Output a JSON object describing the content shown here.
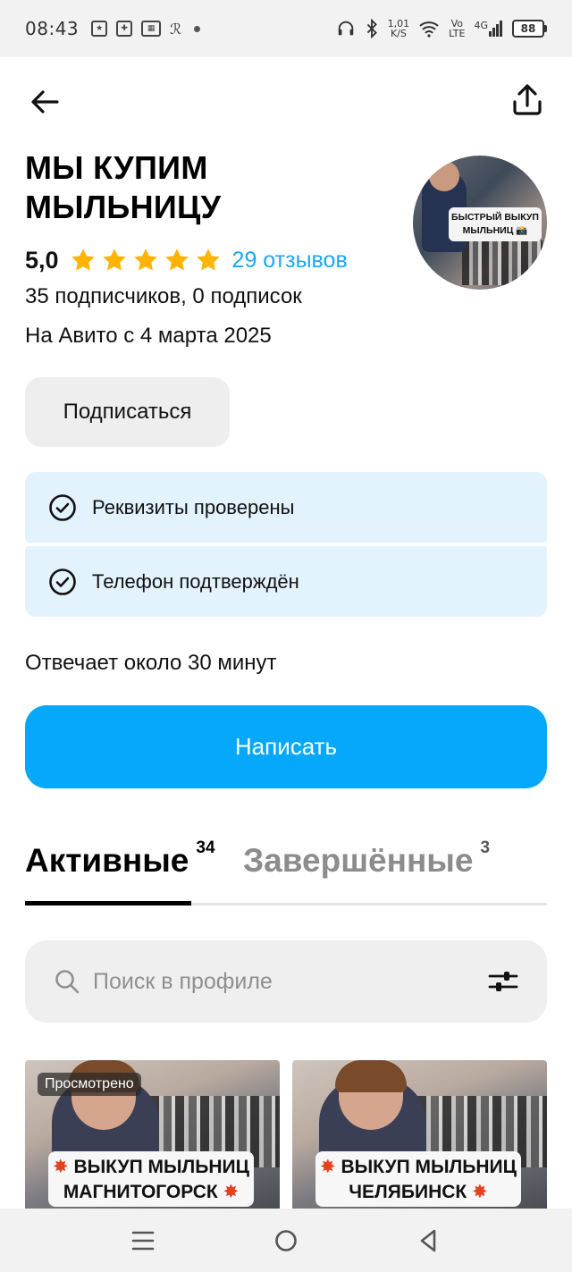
{
  "status_bar": {
    "time": "08:43",
    "net_speed_value": "1,01",
    "net_speed_unit": "K/S",
    "volte_top": "Vo",
    "volte_bottom": "LTE",
    "network": "4G",
    "battery": "88"
  },
  "profile": {
    "name": "МЫ КУПИМ МЫЛЬНИЦУ",
    "avatar_caption": "БЫСТРЫЙ ВЫКУП МЫЛЬНИЦ 📸",
    "rating": "5,0",
    "stars": 5,
    "reviews": "29 отзывов",
    "subscriptions": "35 подписчиков, 0 подписок",
    "since": "На Авито с 4 марта 2025"
  },
  "actions": {
    "subscribe": "Подписаться",
    "write": "Написать"
  },
  "verifications": [
    {
      "label": "Реквизиты проверены"
    },
    {
      "label": "Телефон подтверждён"
    }
  ],
  "response_time": "Отвечает около 30 минут",
  "tabs": [
    {
      "label": "Активные",
      "count": "34"
    },
    {
      "label": "Завершённые",
      "count": "3"
    }
  ],
  "search": {
    "placeholder": "Поиск в профиле"
  },
  "listings": [
    {
      "badge": "Просмотрено",
      "line1": "ВЫКУП МЫЛЬНИЦ",
      "line2": "МАГНИТОГОРСК"
    },
    {
      "badge": "",
      "line1": "ВЫКУП МЫЛЬНИЦ",
      "line2": "ЧЕЛЯБИНСК"
    }
  ],
  "colors": {
    "accent": "#06a8fb",
    "link": "#1aa7f0",
    "star": "#ffb400",
    "verify_bg": "#e2f3fd"
  }
}
